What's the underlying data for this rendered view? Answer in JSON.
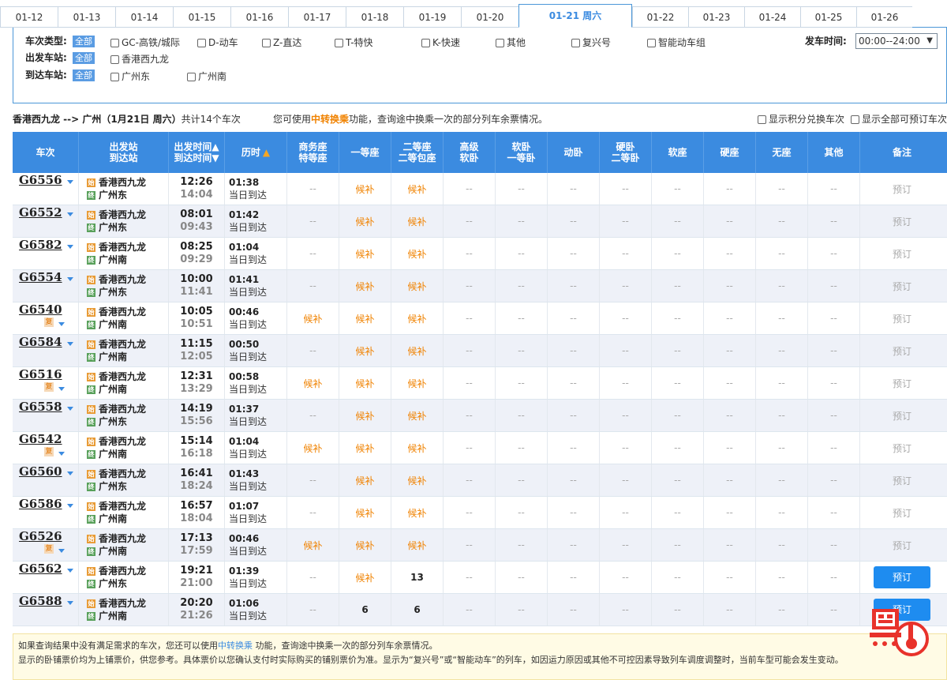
{
  "dates": [
    "01-12",
    "01-13",
    "01-14",
    "01-15",
    "01-16",
    "01-17",
    "01-18",
    "01-19",
    "01-20",
    "01-21 周六",
    "01-22",
    "01-23",
    "01-24",
    "01-25",
    "01-26"
  ],
  "active_date_index": 9,
  "filters": {
    "train_type_label": "车次类型:",
    "all": "全部",
    "train_types": [
      "GC-高铁/城际",
      "D-动车",
      "Z-直达",
      "T-特快",
      "K-快速",
      "其他",
      "复兴号",
      "智能动车组"
    ],
    "from_label": "出发车站:",
    "from_stations": [
      "香港西九龙"
    ],
    "to_label": "到达车站:",
    "to_stations": [
      "广州东",
      "广州南"
    ],
    "time_label": "发车时间:",
    "time_value": "00:00--24:00"
  },
  "summary": {
    "route": "香港西九龙 --> 广州（1月21日  周六）",
    "count": "共计14个车次",
    "hint_pre": "您可使用",
    "hint_link": "中转换乘",
    "hint_post": "功能，查询途中换乘一次的部分列车余票情况。",
    "opt1": "显示积分兑换车次",
    "opt2": "显示全部可预订车次"
  },
  "headers": {
    "train": "车次",
    "station_a": "出发站",
    "station_b": "到达站",
    "time_a": "出发时间▲",
    "time_b": "到达时间▼",
    "duration": "历时",
    "biz_a": "商务座",
    "biz_b": "特等座",
    "first": "一等座",
    "second_a": "二等座",
    "second_b": "二等包座",
    "hsoft_a": "高级",
    "hsoft_b": "软卧",
    "soft_a": "软卧",
    "soft_b": "一等卧",
    "dong": "动卧",
    "hard_a": "硬卧",
    "hard_b": "二等卧",
    "softseat": "软座",
    "hardseat": "硬座",
    "noseat": "无座",
    "other": "其他",
    "note": "备注"
  },
  "trains": [
    {
      "no": "G6556",
      "fu": false,
      "from": "香港西九龙",
      "to": "广州东",
      "dep": "12:26",
      "arr": "14:04",
      "dur": "01:38",
      "day": "当日到达",
      "biz": "--",
      "first": "候补",
      "second": "候补",
      "book": "预订",
      "active": false
    },
    {
      "no": "G6552",
      "fu": false,
      "from": "香港西九龙",
      "to": "广州东",
      "dep": "08:01",
      "arr": "09:43",
      "dur": "01:42",
      "day": "当日到达",
      "biz": "--",
      "first": "候补",
      "second": "候补",
      "book": "预订",
      "active": false
    },
    {
      "no": "G6582",
      "fu": false,
      "from": "香港西九龙",
      "to": "广州南",
      "dep": "08:25",
      "arr": "09:29",
      "dur": "01:04",
      "day": "当日到达",
      "biz": "--",
      "first": "候补",
      "second": "候补",
      "book": "预订",
      "active": false
    },
    {
      "no": "G6554",
      "fu": false,
      "from": "香港西九龙",
      "to": "广州东",
      "dep": "10:00",
      "arr": "11:41",
      "dur": "01:41",
      "day": "当日到达",
      "biz": "--",
      "first": "候补",
      "second": "候补",
      "book": "预订",
      "active": false
    },
    {
      "no": "G6540",
      "fu": true,
      "from": "香港西九龙",
      "to": "广州南",
      "dep": "10:05",
      "arr": "10:51",
      "dur": "00:46",
      "day": "当日到达",
      "biz": "候补",
      "first": "候补",
      "second": "候补",
      "book": "预订",
      "active": false
    },
    {
      "no": "G6584",
      "fu": false,
      "from": "香港西九龙",
      "to": "广州南",
      "dep": "11:15",
      "arr": "12:05",
      "dur": "00:50",
      "day": "当日到达",
      "biz": "--",
      "first": "候补",
      "second": "候补",
      "book": "预订",
      "active": false
    },
    {
      "no": "G6516",
      "fu": true,
      "from": "香港西九龙",
      "to": "广州南",
      "dep": "12:31",
      "arr": "13:29",
      "dur": "00:58",
      "day": "当日到达",
      "biz": "候补",
      "first": "候补",
      "second": "候补",
      "book": "预订",
      "active": false
    },
    {
      "no": "G6558",
      "fu": false,
      "from": "香港西九龙",
      "to": "广州东",
      "dep": "14:19",
      "arr": "15:56",
      "dur": "01:37",
      "day": "当日到达",
      "biz": "--",
      "first": "候补",
      "second": "候补",
      "book": "预订",
      "active": false
    },
    {
      "no": "G6542",
      "fu": true,
      "from": "香港西九龙",
      "to": "广州南",
      "dep": "15:14",
      "arr": "16:18",
      "dur": "01:04",
      "day": "当日到达",
      "biz": "候补",
      "first": "候补",
      "second": "候补",
      "book": "预订",
      "active": false
    },
    {
      "no": "G6560",
      "fu": false,
      "from": "香港西九龙",
      "to": "广州东",
      "dep": "16:41",
      "arr": "18:24",
      "dur": "01:43",
      "day": "当日到达",
      "biz": "--",
      "first": "候补",
      "second": "候补",
      "book": "预订",
      "active": false
    },
    {
      "no": "G6586",
      "fu": false,
      "from": "香港西九龙",
      "to": "广州南",
      "dep": "16:57",
      "arr": "18:04",
      "dur": "01:07",
      "day": "当日到达",
      "biz": "--",
      "first": "候补",
      "second": "候补",
      "book": "预订",
      "active": false
    },
    {
      "no": "G6526",
      "fu": true,
      "from": "香港西九龙",
      "to": "广州南",
      "dep": "17:13",
      "arr": "17:59",
      "dur": "00:46",
      "day": "当日到达",
      "biz": "候补",
      "first": "候补",
      "second": "候补",
      "book": "预订",
      "active": false
    },
    {
      "no": "G6562",
      "fu": false,
      "from": "香港西九龙",
      "to": "广州东",
      "dep": "19:21",
      "arr": "21:00",
      "dur": "01:39",
      "day": "当日到达",
      "biz": "--",
      "first": "候补",
      "second": "13",
      "book": "预订",
      "active": true
    },
    {
      "no": "G6588",
      "fu": false,
      "from": "香港西九龙",
      "to": "广州南",
      "dep": "20:20",
      "arr": "21:26",
      "dur": "01:06",
      "day": "当日到达",
      "biz": "--",
      "first": "6",
      "second": "6",
      "book": "预订",
      "active": true
    }
  ],
  "dash": "--",
  "fu_label": "复",
  "icon_start": "始",
  "icon_end": "终",
  "notice": {
    "l1_pre": "如果查询结果中没有满足需求的车次，您还可以使用",
    "l1_link": "中转换乘",
    "l1_post": " 功能，查询途中换乘一次的部分列车余票情况。",
    "l2": "显示的卧铺票价均为上铺票价，供您参考。具体票价以您确认支付时实际购买的铺别票价为准。显示为“复兴号”或“智能动车”的列车，如因运力原因或其他不可控因素导致列车调度调整时，当前车型可能会发生变动。"
  },
  "colors": {
    "accent": "#3b8be0",
    "orange": "#f08200",
    "button": "#1e8cf0",
    "logo": "#e8322b"
  }
}
